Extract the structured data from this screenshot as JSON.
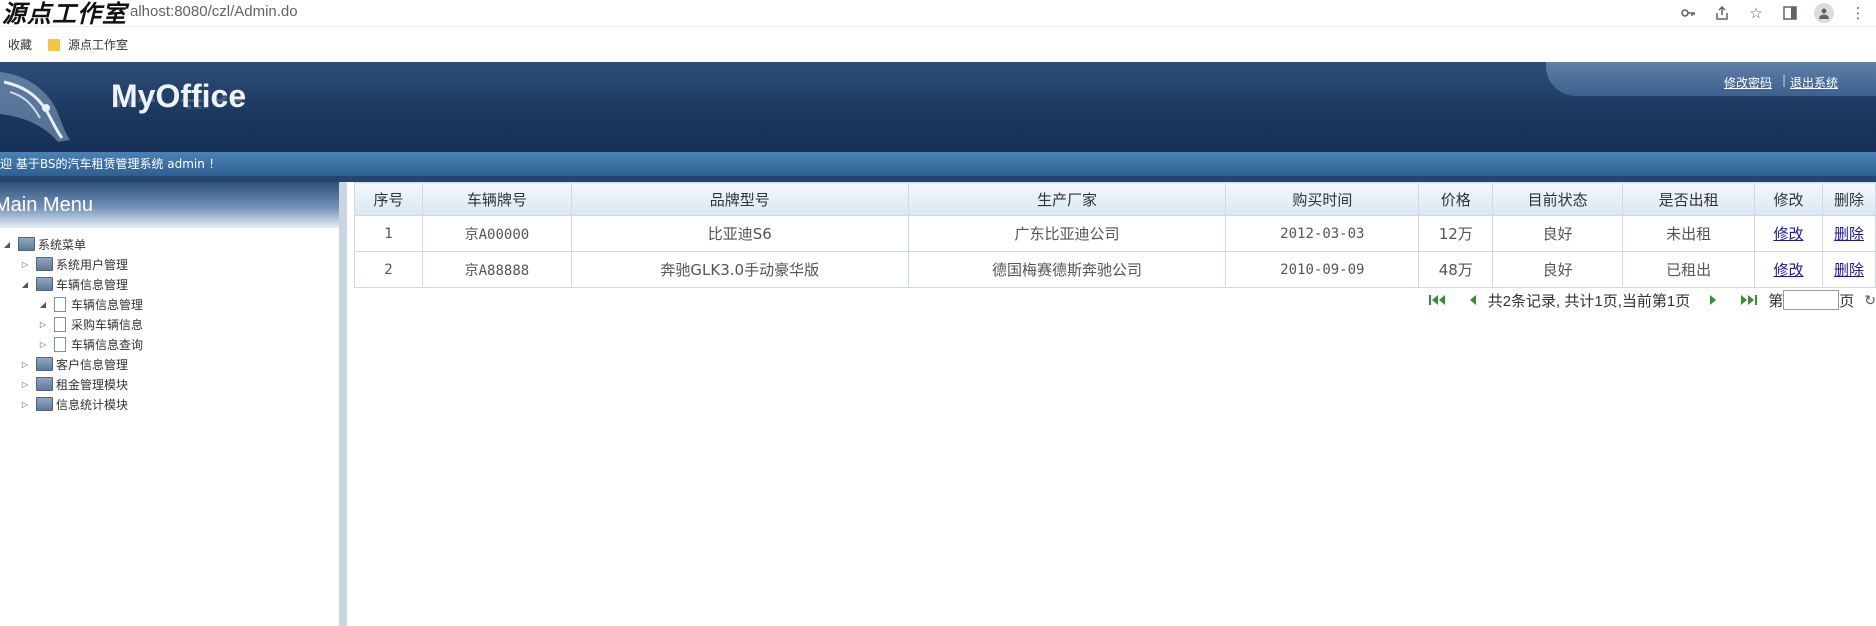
{
  "browser": {
    "watermark": "源点工作室",
    "url": "alhost:8080/czl/Admin.do",
    "bookmarks": {
      "favorites": "收藏",
      "folder": "源点工作室"
    }
  },
  "header": {
    "logo": "MyOffice",
    "links": {
      "change_password": "修改密码",
      "separator": "|",
      "logout": "退出系统"
    },
    "welcome": "迎 基于BS的汽车租赁管理系统 admin ！"
  },
  "sidebar": {
    "title": "Main Menu",
    "tree": {
      "root": "系统菜单",
      "items": [
        {
          "label": "系统用户管理"
        },
        {
          "label": "车辆信息管理",
          "children": [
            "车辆信息管理",
            "采购车辆信息",
            "车辆信息查询"
          ]
        },
        {
          "label": "客户信息管理"
        },
        {
          "label": "租金管理模块"
        },
        {
          "label": "信息统计模块"
        }
      ]
    }
  },
  "table": {
    "headers": [
      "序号",
      "车辆牌号",
      "品牌型号",
      "生产厂家",
      "购买时间",
      "价格",
      "目前状态",
      "是否出租",
      "修改",
      "删除"
    ],
    "rows": [
      {
        "no": "1",
        "plate": "京A00000",
        "model": "比亚迪S6",
        "maker": "广东比亚迪公司",
        "date": "2012-03-03",
        "price": "12万",
        "status": "良好",
        "rented": "未出租",
        "edit": "修改",
        "del": "删除"
      },
      {
        "no": "2",
        "plate": "京A88888",
        "model": "奔驰GLK3.0手动豪华版",
        "maker": "德国梅赛德斯奔驰公司",
        "date": "2010-09-09",
        "price": "48万",
        "status": "良好",
        "rented": "已租出",
        "edit": "修改",
        "del": "删除"
      }
    ]
  },
  "pager": {
    "summary": "共2条记录, 共计1页,当前第1页",
    "page_prefix": "第",
    "page_suffix": "页",
    "page_value": ""
  }
}
